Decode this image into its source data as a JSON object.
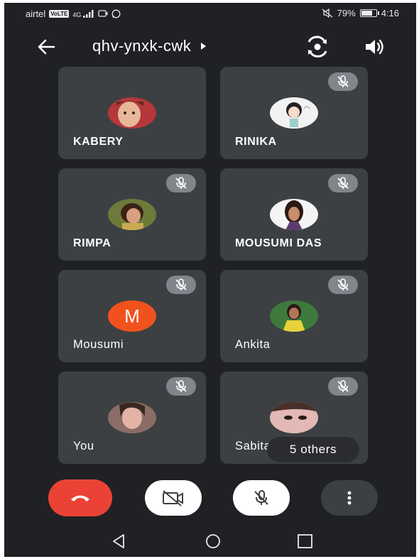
{
  "status_bar": {
    "carrier": "airtel",
    "network_badge": "VoLTE",
    "signal_label": "4G",
    "battery_percent": "79%",
    "battery_level": 0.79,
    "time": "4:16"
  },
  "top_bar": {
    "meeting_code": "qhv-ynxk-cwk"
  },
  "participants": [
    {
      "name": "KABERY",
      "muted": false,
      "avatar": "photo"
    },
    {
      "name": "RINIKA",
      "muted": true,
      "avatar": "photo"
    },
    {
      "name": "RIMPA",
      "muted": true,
      "avatar": "photo"
    },
    {
      "name": "MOUSUMI DAS",
      "muted": true,
      "avatar": "photo"
    },
    {
      "name": "Mousumi",
      "muted": true,
      "avatar": "letter",
      "letter": "M"
    },
    {
      "name": "Ankita",
      "muted": true,
      "avatar": "photo"
    },
    {
      "name": "You",
      "muted": true,
      "avatar": "photo"
    },
    {
      "name": "Sabita",
      "muted": true,
      "avatar": "photo"
    }
  ],
  "others_pill": "5 others",
  "controls": {
    "end_call_icon": "phone-hangup-icon",
    "camera_icon": "camera-off-icon",
    "mic_icon": "mic-off-icon",
    "more_icon": "more-vert-icon"
  },
  "colors": {
    "background": "#202124",
    "tile": "#3c4043",
    "end_call": "#ea4335",
    "letter_avatar": "#f1521d"
  }
}
